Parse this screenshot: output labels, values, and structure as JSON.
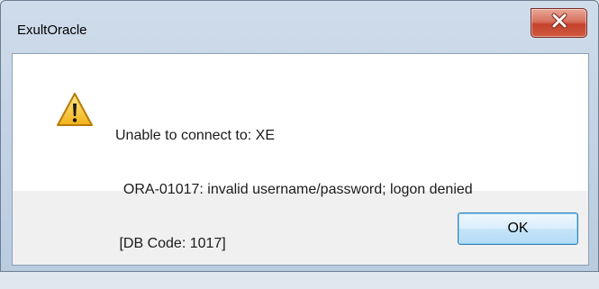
{
  "window": {
    "title": "ExultOracle",
    "close_icon": "close-x-icon",
    "close_color": "#c74a33"
  },
  "dialog": {
    "icon": "warning-triangle-icon",
    "message_lines": [
      "Unable to connect to: XE",
      "  ORA-01017: invalid username/password; logon denied",
      " [DB Code: 1017]"
    ],
    "ok_label": "OK"
  }
}
